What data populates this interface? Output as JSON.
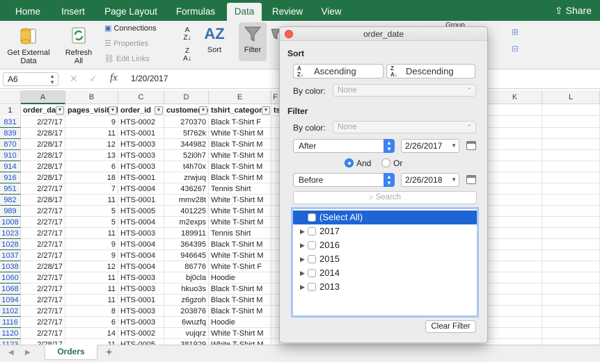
{
  "ribbon_tabs": [
    "Home",
    "Insert",
    "Page Layout",
    "Formulas",
    "Data",
    "Review",
    "View"
  ],
  "share_label": "Share",
  "ribbon": {
    "get_external_1": "Get External",
    "get_external_2": "Data",
    "refresh_1": "Refresh",
    "refresh_2": "All",
    "connections": "Connections",
    "properties": "Properties",
    "edit_links": "Edit Links",
    "sort": "Sort",
    "filter": "Filter",
    "group": "Group"
  },
  "formula_bar": {
    "name_box": "A6",
    "fx": "fx",
    "formula": "1/20/2017"
  },
  "columns": [
    "A",
    "B",
    "C",
    "D",
    "E",
    "F",
    "",
    "",
    "",
    "K",
    "L"
  ],
  "header_row": {
    "row_num": "1",
    "cells": [
      "order_date",
      "pages_visited",
      "order_id",
      "customer_id",
      "tshirt_category",
      "ts"
    ]
  },
  "rows": [
    [
      "831",
      "2/27/17",
      "9",
      "HTS-0002",
      "270370",
      "Black T-Shirt F"
    ],
    [
      "839",
      "2/28/17",
      "11",
      "HTS-0001",
      "5f762k",
      "White T-Shirt M"
    ],
    [
      "870",
      "2/28/17",
      "12",
      "HTS-0003",
      "344982",
      "Black T-Shirt M"
    ],
    [
      "910",
      "2/28/17",
      "13",
      "HTS-0003",
      "52i0h7",
      "White T-Shirt M"
    ],
    [
      "914",
      "2/28/17",
      "6",
      "HTS-0003",
      "t4h70x",
      "Black T-Shirt M"
    ],
    [
      "916",
      "2/28/17",
      "18",
      "HTS-0001",
      "zrwjuq",
      "Black T-Shirt M"
    ],
    [
      "951",
      "2/27/17",
      "7",
      "HTS-0004",
      "436267",
      "Tennis Shirt"
    ],
    [
      "982",
      "2/28/17",
      "11",
      "HTS-0001",
      "mmv28t",
      "White T-Shirt M"
    ],
    [
      "989",
      "2/27/17",
      "5",
      "HTS-0005",
      "401225",
      "White T-Shirt M"
    ],
    [
      "1008",
      "2/27/17",
      "5",
      "HTS-0004",
      "m2exps",
      "White T-Shirt M"
    ],
    [
      "1023",
      "2/27/17",
      "11",
      "HTS-0003",
      "189911",
      "Tennis Shirt"
    ],
    [
      "1028",
      "2/27/17",
      "9",
      "HTS-0004",
      "364395",
      "Black T-Shirt M"
    ],
    [
      "1037",
      "2/27/17",
      "9",
      "HTS-0004",
      "946645",
      "White T-Shirt M"
    ],
    [
      "1038",
      "2/28/17",
      "12",
      "HTS-0004",
      "86776",
      "White T-Shirt F"
    ],
    [
      "1060",
      "2/27/17",
      "11",
      "HTS-0003",
      "bj0cla",
      "Hoodie"
    ],
    [
      "1068",
      "2/27/17",
      "11",
      "HTS-0003",
      "hkuo3s",
      "Black T-Shirt M"
    ],
    [
      "1094",
      "2/27/17",
      "11",
      "HTS-0001",
      "z6gzoh",
      "Black T-Shirt M"
    ],
    [
      "1102",
      "2/27/17",
      "8",
      "HTS-0003",
      "203876",
      "Black T-Shirt M"
    ],
    [
      "1116",
      "2/27/17",
      "6",
      "HTS-0003",
      "6wuzfq",
      "Hoodie"
    ],
    [
      "1120",
      "2/27/17",
      "14",
      "HTS-0002",
      "vujqrz",
      "White T-Shirt M"
    ],
    [
      "1123",
      "2/28/17",
      "11",
      "HTS-0005",
      "381929",
      "White T-Shirt M"
    ]
  ],
  "sheet_tab": "Orders",
  "add_sheet": "+",
  "dialog": {
    "title": "order_date",
    "sort_heading": "Sort",
    "ascending": "Ascending",
    "descending": "Descending",
    "by_color_label": "By color:",
    "sort_color_value": "None",
    "filter_heading": "Filter",
    "filter_color_value": "None",
    "cond1_op": "After",
    "cond1_date": "2/26/2017",
    "and_label": "And",
    "or_label": "Or",
    "cond2_op": "Before",
    "cond2_date": "2/26/2018",
    "search_placeholder": "Search",
    "list_items": [
      "(Select All)",
      "2017",
      "2016",
      "2015",
      "2014",
      "2013"
    ],
    "clear_filter": "Clear Filter"
  },
  "accent_color": "#217346",
  "selection_color": "#1d64d6"
}
